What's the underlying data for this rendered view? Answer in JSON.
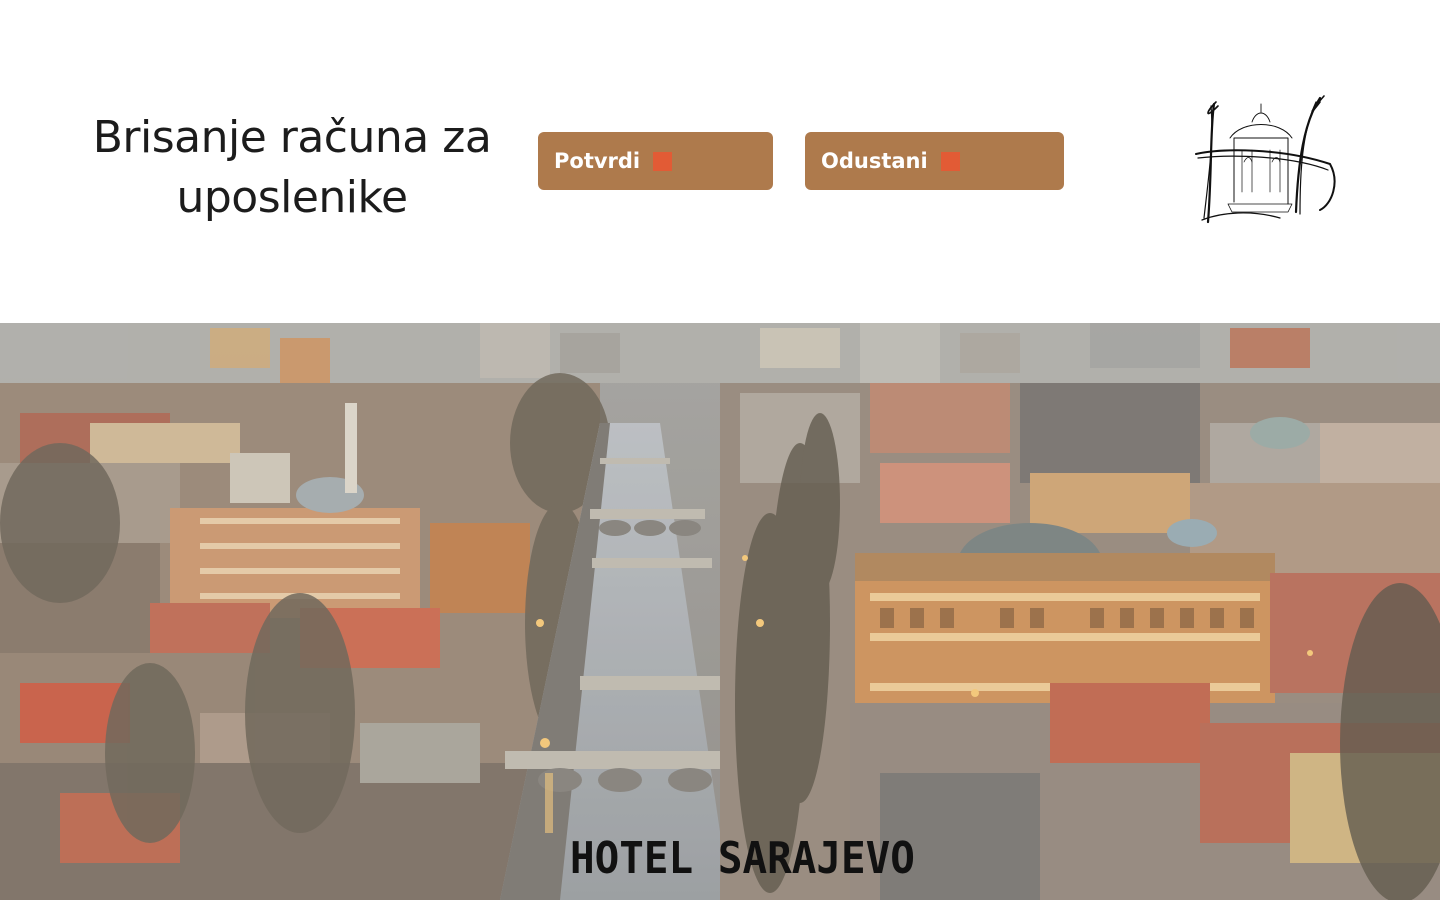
{
  "header": {
    "title": "Brisanje računa za uposlenike",
    "buttons": {
      "confirm_label": "Potvrdi",
      "cancel_label": "Odustani"
    },
    "logo_icon": "hotel-monogram-logo"
  },
  "hero": {
    "image": "sarajevo-city-panorama",
    "brand": "HOTEL SARAJEVO"
  },
  "colors": {
    "button_bg": "#ae7a4c",
    "button_text": "#ffffff",
    "button_marker": "#e25b35",
    "title_text": "#1c1c1c"
  }
}
